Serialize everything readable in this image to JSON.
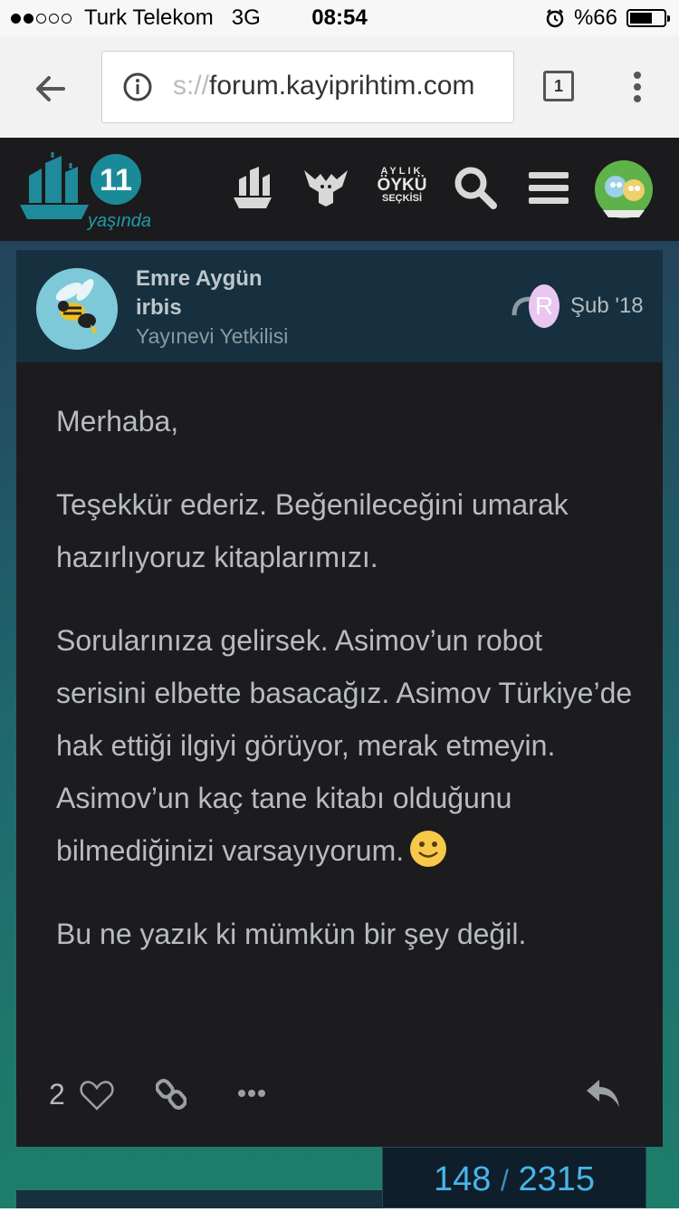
{
  "status_bar": {
    "carrier": "Turk Telekom",
    "network": "3G",
    "time": "08:54",
    "battery_label": "%66",
    "battery_level": 0.66,
    "signal_bars_filled": 2,
    "signal_bars_total": 5
  },
  "browser": {
    "url_faded": "s://",
    "url_main": "forum.kayiprihtim.com",
    "tab_count": "1"
  },
  "site_header": {
    "logo_number": "11",
    "logo_text": "yaşında",
    "monthly_label_top": "AYLIK",
    "monthly_label_mid": "ÖYKÜ",
    "monthly_label_bot": "SEÇKİSİ"
  },
  "post": {
    "author_name": "Emre Aygün",
    "username": "irbis",
    "user_title": "Yayınevi Yetkilisi",
    "reply_avatar_letter": "R",
    "date": "Şub '18",
    "paragraphs": [
      "Merhaba,",
      "Teşekkür ederiz. Beğenileceğini umarak hazırlıyoruz kitaplarımızı.",
      "Sorularınıza gelirsek. Asimov’un robot serisini elbette basacağız. Asimov Türkiye’de hak ettiği ilgiyi görüyor, merak etmeyin. Asimov’un kaç tane kitabı olduğunu bilmediğinizi varsayıyorum.",
      "Bu ne yazık ki mümkün bir şey değil."
    ],
    "like_count": "2"
  },
  "progress": {
    "current": "148",
    "separator": "/",
    "total": "2315"
  },
  "colors": {
    "header_bg": "#1b1b1d",
    "post_head_bg": "#16303f",
    "post_body_bg": "#1c1c1f",
    "accent_teal": "#1f8a9a",
    "progress_text": "#47b4e8"
  },
  "icons": [
    "back-arrow-icon",
    "info-icon",
    "tabs-icon",
    "overflow-menu-icon",
    "ship-icon",
    "griffin-icon",
    "search-icon",
    "hamburger-icon",
    "heart-icon",
    "link-icon",
    "more-icon",
    "reply-icon",
    "smiley-icon"
  ]
}
